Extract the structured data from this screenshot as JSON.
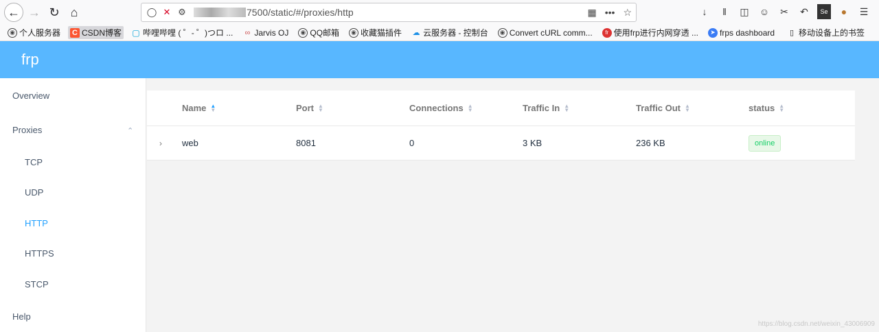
{
  "browser": {
    "url": "7500/static/#/proxies/http",
    "bookmarks": [
      {
        "label": "个人服务器",
        "icon": "globe"
      },
      {
        "label": "CSDN博客",
        "icon": "csdn",
        "active": true
      },
      {
        "label": "哔哩哔哩 ( ゜- ゜)つロ ...",
        "icon": "bili"
      },
      {
        "label": "Jarvis OJ",
        "icon": "jarvis"
      },
      {
        "label": "QQ邮箱",
        "icon": "globe"
      },
      {
        "label": "收藏猫插件",
        "icon": "globe"
      },
      {
        "label": "云服务器 - 控制台",
        "icon": "cloud"
      },
      {
        "label": "Convert cURL comm...",
        "icon": "globe"
      },
      {
        "label": "使用frp进行内网穿透 ...",
        "icon": "frp"
      },
      {
        "label": "frps dashboard",
        "icon": "frps"
      }
    ],
    "mobile_bookmarks": "移动设备上的书签"
  },
  "app": {
    "logo": "frp"
  },
  "sidebar": {
    "overview": "Overview",
    "proxies": "Proxies",
    "sub": [
      "TCP",
      "UDP",
      "HTTP",
      "HTTPS",
      "STCP"
    ],
    "active": "HTTP",
    "help": "Help"
  },
  "table": {
    "headers": [
      "Name",
      "Port",
      "Connections",
      "Traffic In",
      "Traffic Out",
      "status"
    ],
    "rows": [
      {
        "name": "web",
        "port": "8081",
        "connections": "0",
        "traffic_in": "3 KB",
        "traffic_out": "236 KB",
        "status": "online"
      }
    ]
  },
  "watermark": "https://blog.csdn.net/weixin_43006909",
  "colors": {
    "header_bg": "#58b7ff",
    "active_menu": "#20a0ff",
    "online": "#13ce66"
  }
}
